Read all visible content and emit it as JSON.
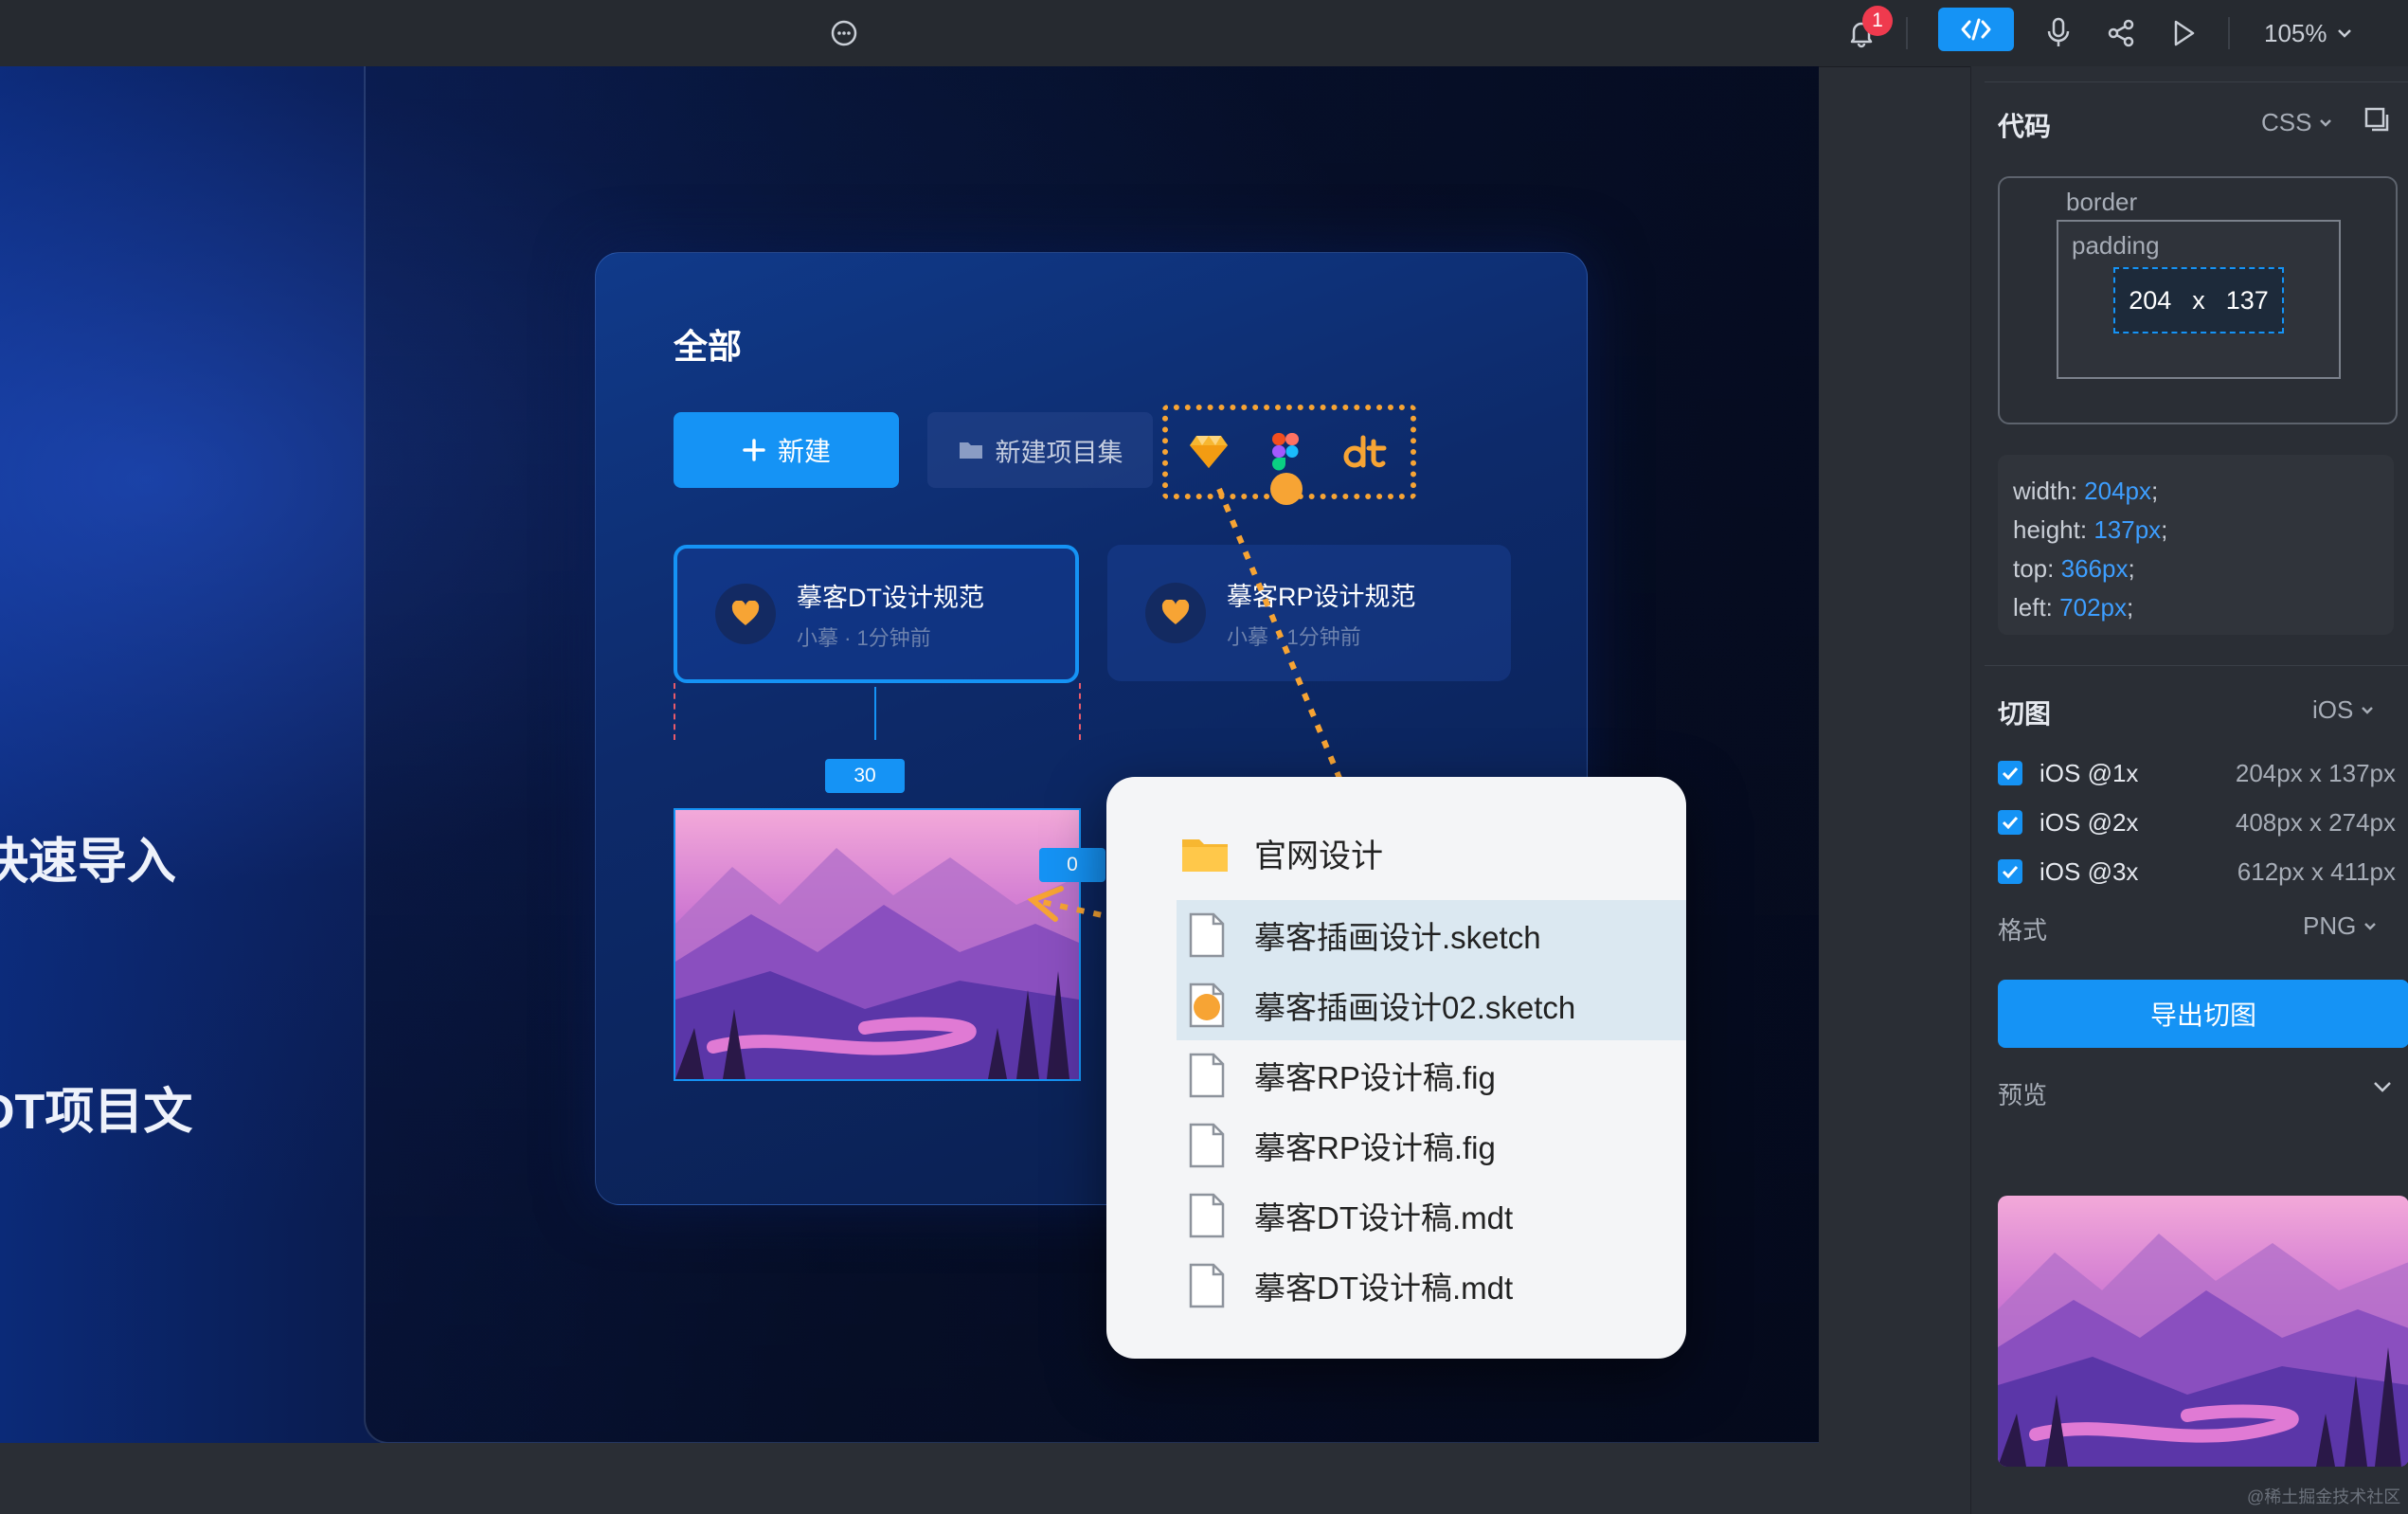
{
  "topbar": {
    "notification_count": "1",
    "zoom": "105%"
  },
  "hero": {
    "line1": "快速导入",
    "line2": "DT项目文"
  },
  "card": {
    "title": "全部",
    "new_button": "新建",
    "collection_button": "新建项目集",
    "projects": [
      {
        "name": "摹客DT设计规范",
        "meta": "小摹 · 1分钟前"
      },
      {
        "name": "摹客RP设计规范",
        "meta": "小摹 · 1分钟前"
      }
    ],
    "measure_vertical": "30",
    "measure_horizontal": "0"
  },
  "file_popup": {
    "folder": "官网设计",
    "files": [
      "摹客插画设计.sketch",
      "摹客插画设计02.sketch",
      "摹客RP设计稿.fig",
      "摹客RP设计稿.fig",
      "摹客DT设计稿.mdt",
      "摹客DT设计稿.mdt"
    ]
  },
  "panel": {
    "code_title": "代码",
    "code_lang": "CSS",
    "box_border": "border",
    "box_padding": "padding",
    "box_width": "204",
    "box_x": "x",
    "box_height": "137",
    "css": {
      "width_k": "width:",
      "width_v": "204px",
      "height_k": "height:",
      "height_v": "137px",
      "top_k": "top:",
      "top_v": "366px",
      "left_k": "left:",
      "left_v": "702px"
    },
    "slice_title": "切图",
    "slice_platform": "iOS",
    "slices": [
      {
        "label": "iOS @1x",
        "size": "204px x 137px"
      },
      {
        "label": "iOS @2x",
        "size": "408px x 274px"
      },
      {
        "label": "iOS @3x",
        "size": "612px x 411px"
      }
    ],
    "format_label": "格式",
    "format_value": "PNG",
    "export_button": "导出切图",
    "preview_label": "预览"
  },
  "watermark": "@稀土掘金技术社区",
  "colors": {
    "accent": "#1593f5",
    "highlight": "#f7a434",
    "badge": "#ef3a4e"
  }
}
